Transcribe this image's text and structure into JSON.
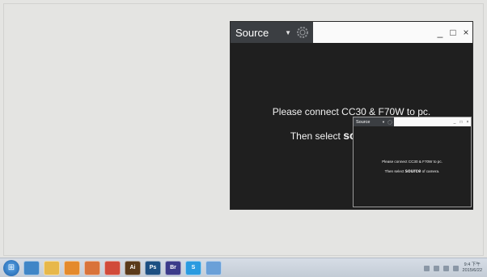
{
  "window": {
    "source_label": "Source",
    "controls": {
      "minimize": "_",
      "maximize": "□",
      "close": "×"
    },
    "message_line1": "Please connect CC30 & F70W to pc.",
    "message_line2_prefix": "Then select",
    "message_line2_keyword": "source",
    "message_line2_suffix": "of camera."
  },
  "colors": {
    "window_bg": "#1f1f1f",
    "source_box_bg": "#3b3e42",
    "titlebar_bg": "#fafafa",
    "desktop_bg": "#e4e4e2"
  },
  "taskbar": {
    "start_icon": "windows-orb-icon",
    "apps": [
      {
        "name": "explorer-icon",
        "label": "",
        "color": "#3f86c7"
      },
      {
        "name": "folder-icon",
        "label": "",
        "color": "#e7b84b"
      },
      {
        "name": "media-icon",
        "label": "",
        "color": "#e48a2c"
      },
      {
        "name": "app-orange-icon",
        "label": "",
        "color": "#d9733a"
      },
      {
        "name": "chrome-icon",
        "label": "",
        "color": "#d14a3a"
      },
      {
        "name": "illustrator-icon",
        "label": "Ai",
        "color": "#5a3a1a"
      },
      {
        "name": "photoshop-icon",
        "label": "Ps",
        "color": "#1c4f82"
      },
      {
        "name": "bridge-icon",
        "label": "Br",
        "color": "#3b3b8a"
      },
      {
        "name": "skype-icon",
        "label": "S",
        "color": "#2a9be0"
      },
      {
        "name": "photo-viewer-icon",
        "label": "",
        "color": "#6aa0d8"
      }
    ],
    "clock_time": "9:4 下午",
    "clock_date": "2015/6/22"
  }
}
